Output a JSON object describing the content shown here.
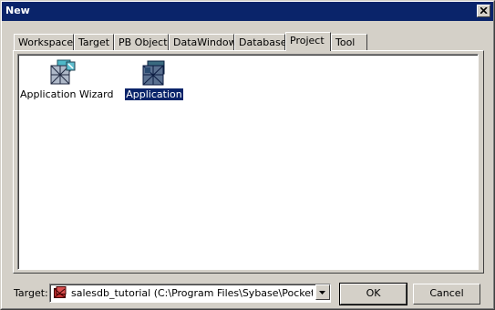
{
  "window": {
    "title": "New"
  },
  "tabs": [
    {
      "label": "Workspace"
    },
    {
      "label": "Target"
    },
    {
      "label": "PB Object"
    },
    {
      "label": "DataWindow"
    },
    {
      "label": "Database"
    },
    {
      "label": "Project",
      "active": true
    },
    {
      "label": "Tool"
    }
  ],
  "items": [
    {
      "label": "Application Wizard",
      "icon": "application-wizard-icon"
    },
    {
      "label": "Application",
      "icon": "application-icon",
      "selected": true
    }
  ],
  "target": {
    "label": "Target:",
    "value": "salesdb_tutorial (C:\\Program Files\\Sybase\\PocketBuilder",
    "icon": "target-icon"
  },
  "buttons": {
    "ok": "OK",
    "cancel": "Cancel"
  },
  "colors": {
    "titlebar": "#0a246a",
    "face": "#d4d0c8",
    "selection": "#0a246a"
  }
}
